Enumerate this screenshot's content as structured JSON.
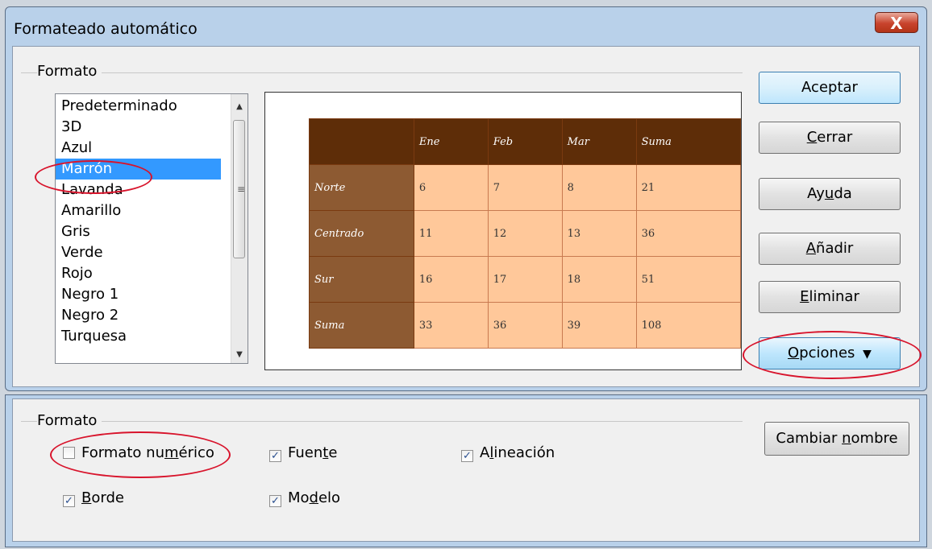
{
  "dialog": {
    "title": "Formateado automático",
    "close_label": "X"
  },
  "format_group": {
    "label": "Formato",
    "list": {
      "items": [
        "Predeterminado",
        "3D",
        "Azul",
        "Marrón",
        "Lavanda",
        "Amarillo",
        "Gris",
        "Verde",
        "Rojo",
        "Negro 1",
        "Negro 2",
        "Turquesa"
      ],
      "selected": "Marrón"
    }
  },
  "preview_table": {
    "headers": [
      "",
      "Ene",
      "Feb",
      "Mar",
      "Suma"
    ],
    "rows": [
      {
        "label": "Norte",
        "values": [
          "6",
          "7",
          "8",
          "21"
        ]
      },
      {
        "label": "Centrado",
        "values": [
          "11",
          "12",
          "13",
          "36"
        ]
      },
      {
        "label": "Sur",
        "values": [
          "16",
          "17",
          "18",
          "51"
        ]
      },
      {
        "label": "Suma",
        "values": [
          "33",
          "36",
          "39",
          "108"
        ]
      }
    ],
    "colors": {
      "header": "#5e2d08",
      "row_header": "#8d5a32",
      "cell": "#ffc89a"
    }
  },
  "buttons": {
    "accept": "Aceptar",
    "close": {
      "pre": "",
      "u": "C",
      "post": "errar"
    },
    "help": {
      "pre": "Ay",
      "u": "u",
      "post": "da"
    },
    "add": {
      "pre": "",
      "u": "A",
      "post": "ñadir"
    },
    "delete": {
      "pre": "",
      "u": "E",
      "post": "liminar"
    },
    "options": {
      "pre": "",
      "u": "O",
      "post": "pciones"
    },
    "rename": {
      "pre": "Cambiar ",
      "u": "n",
      "post": "ombre"
    }
  },
  "options_group": {
    "label": "Formato",
    "checkboxes": {
      "number_format": {
        "pre": "Formato nu",
        "u": "m",
        "post": "érico",
        "checked": false
      },
      "font": {
        "pre": "Fuen",
        "u": "t",
        "post": "e",
        "checked": true
      },
      "alignment": {
        "pre": "A",
        "u": "l",
        "post": "ineación",
        "checked": true
      },
      "border": {
        "pre": "",
        "u": "B",
        "post": "orde",
        "checked": true
      },
      "model": {
        "pre": "Mo",
        "u": "d",
        "post": "elo",
        "checked": true
      }
    }
  },
  "annotation_color": "#d8142c"
}
